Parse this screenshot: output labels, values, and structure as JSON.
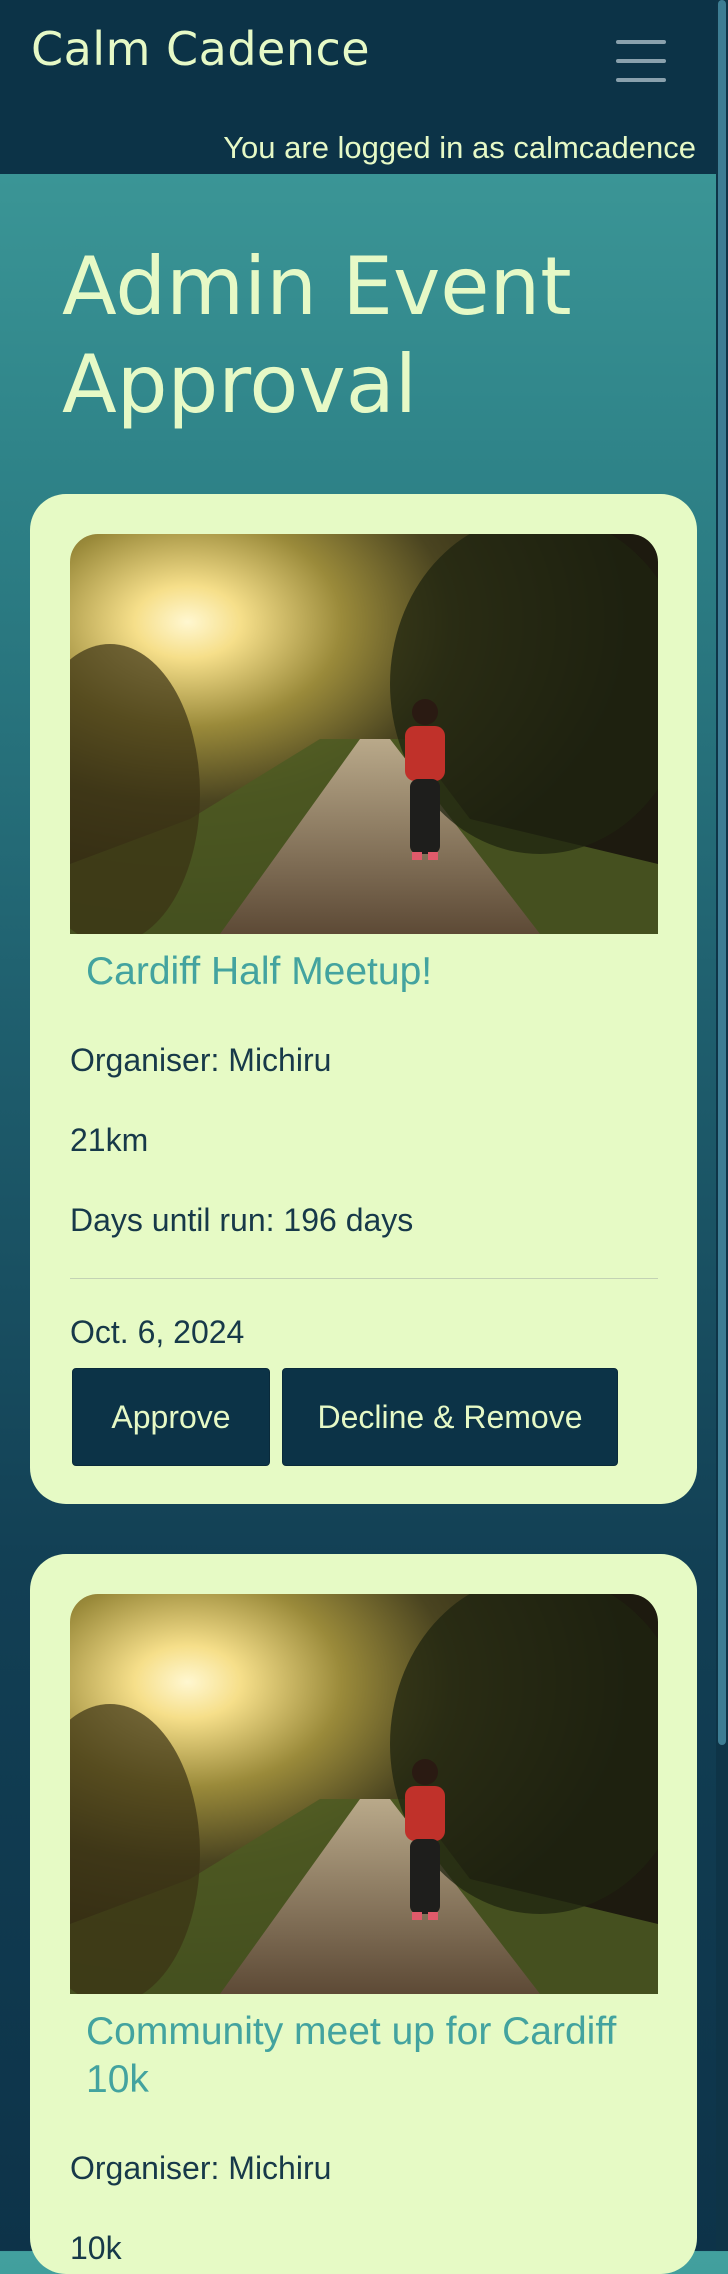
{
  "header": {
    "brand": "Calm Cadence",
    "login_status": "You are logged in as calmcadence"
  },
  "page": {
    "title": "Admin Event Approval"
  },
  "events": [
    {
      "title": "Cardiff Half Meetup!",
      "organiser": "Organiser: Michiru",
      "distance": "21km",
      "days_until": "Days until run: 196 days",
      "date": "Oct. 6, 2024",
      "approve_label": "Approve",
      "decline_label": "Decline & Remove"
    },
    {
      "title": "Community meet up for Cardiff 10k",
      "organiser": "Organiser: Michiru",
      "distance": "10k"
    }
  ],
  "colors": {
    "navbar": "#0c3347",
    "card": "#e6fac5",
    "accent_text": "#43a39f",
    "brand_text": "#e6f9c6"
  }
}
